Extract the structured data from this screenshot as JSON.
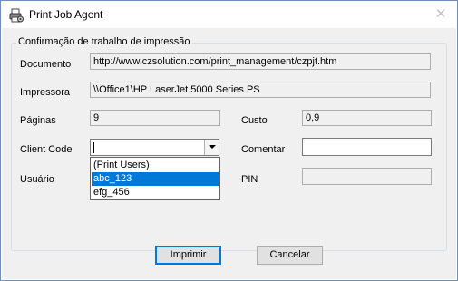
{
  "window": {
    "title": "Print Job Agent",
    "icon": "printer-gear-icon",
    "close_icon": "close-icon"
  },
  "group": {
    "caption": "Confirmação de trabalho de impressão"
  },
  "fields": {
    "documento": {
      "label": "Documento",
      "value": "http://www.czsolution.com/print_management/czpjt.htm"
    },
    "impressora": {
      "label": "Impressora",
      "value": "\\\\Office1\\HP LaserJet 5000 Series PS"
    },
    "paginas": {
      "label": "Páginas",
      "value": "9"
    },
    "custo": {
      "label": "Custo",
      "value": "0,9"
    },
    "client_code": {
      "label": "Client Code",
      "value": ""
    },
    "comentar": {
      "label": "Comentar",
      "value": ""
    },
    "usuario": {
      "label": "Usuário"
    },
    "pin": {
      "label": "PIN",
      "value": ""
    }
  },
  "client_code_options": [
    "(Print Users)",
    "abc_123",
    "efg_456"
  ],
  "client_code_highlighted_index": 1,
  "buttons": {
    "imprimir": "Imprimir",
    "cancelar": "Cancelar"
  },
  "colors": {
    "selection": "#0078d7",
    "window_border": "#6f8fb4",
    "client_background": "#f0f0f0"
  }
}
